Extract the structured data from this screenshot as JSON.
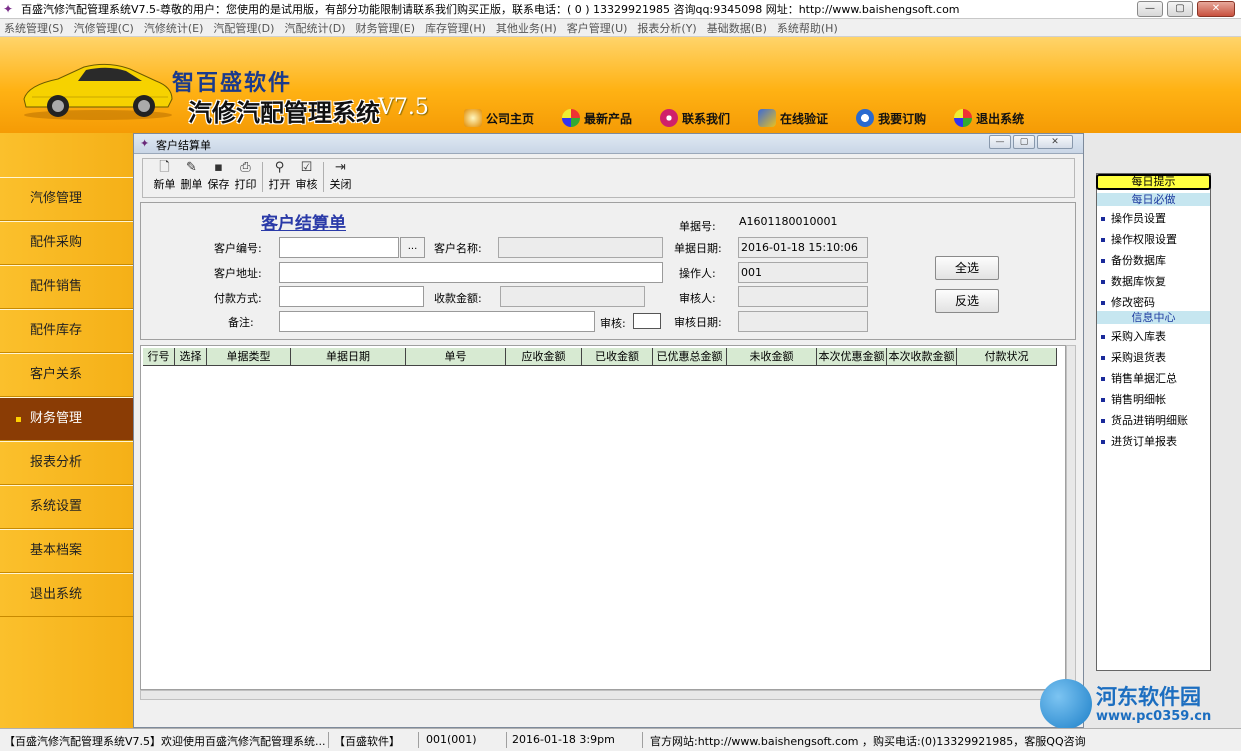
{
  "window": {
    "title": "百盛汽修汽配管理系统V7.5-尊敬的用户：您使用的是试用版，有部分功能限制请联系我们购买正版，联系电话：( 0 ) 13329921985 咨询qq:9345098   网址：http://www.baishengsoft.com"
  },
  "menu": [
    "系统管理(S)",
    "汽修管理(C)",
    "汽修统计(E)",
    "汽配管理(D)",
    "汽配统计(D)",
    "财务管理(E)",
    "库存管理(H)",
    "其他业务(H)",
    "客户管理(U)",
    "报表分析(Y)",
    "基础数据(B)",
    "系统帮助(H)"
  ],
  "banner": {
    "logo_top": "智百盛软件",
    "logo_main": "汽修汽配管理系统",
    "logo_version": "V7.5",
    "nav": [
      "公司主页",
      "最新产品",
      "联系我们",
      "在线验证",
      "我要订购",
      "退出系统"
    ]
  },
  "sidebar": {
    "items": [
      "汽修管理",
      "配件采购",
      "配件销售",
      "配件库存",
      "客户关系",
      "财务管理",
      "报表分析",
      "系统设置",
      "基本档案",
      "退出系统"
    ],
    "active_index": 5
  },
  "child_window": {
    "title": "客户结算单",
    "toolbar": [
      "新单",
      "删单",
      "保存",
      "打印",
      "打开",
      "审核",
      "关闭"
    ],
    "form": {
      "title": "客户结算单",
      "customer_no_label": "客户编号:",
      "customer_no_value": "",
      "customer_no_button": "...",
      "customer_name_label": "客户名称:",
      "customer_name_value": "",
      "customer_address_label": "客户地址:",
      "customer_address_value": "",
      "payment_method_label": "付款方式:",
      "payment_method_value": "",
      "received_amount_label": "收款金额:",
      "received_amount_value": "",
      "remark_label": "备注:",
      "remark_value": "",
      "audit_label": "审核:",
      "doc_no_label": "单据号:",
      "doc_no_value": "A1601180010001",
      "doc_date_label": "单据日期:",
      "doc_date_value": "2016-01-18 15:10:06",
      "operator_label": "操作人:",
      "operator_value": "001",
      "auditor_label": "审核人:",
      "auditor_value": "",
      "audit_date_label": "审核日期:",
      "audit_date_value": "",
      "select_all_button": "全选",
      "invert_button": "反选"
    },
    "table": {
      "columns": [
        "行号",
        "选择",
        "单据类型",
        "单据日期",
        "单号",
        "应收金额",
        "已收金额",
        "已优惠总金额",
        "未收金额",
        "本次优惠金额",
        "本次收款金额",
        "付款状况"
      ],
      "rows": []
    }
  },
  "right_panel": {
    "header": "每日提示",
    "section1": "每日必做",
    "section1_items": [
      "操作员设置",
      "操作权限设置",
      "备份数据库",
      "数据库恢复",
      "修改密码"
    ],
    "section2": "信息中心",
    "section2_items": [
      "采购入库表",
      "采购退货表",
      "销售单据汇总",
      "销售明细帐",
      "货品进销明细账",
      "进货订单报表"
    ]
  },
  "watermark": {
    "name": "河东软件园",
    "url": "www.pc0359.cn"
  },
  "status_bar": {
    "app": "【百盛汽修汽配管理系统V7.5】欢迎使用百盛汽修汽配管理系统...",
    "company": "【百盛软件】",
    "user": "001(001)",
    "datetime": "2016-01-18 3:9pm",
    "info": "官方网站:http://www.baishengsoft.com ，购买电话:(0)13329921985，客服QQ咨询"
  },
  "colors": {
    "banner": "#ffb214",
    "sidebar": "#f7b41f",
    "sidebar_active": "#8a3c05",
    "grid_header": "#d7ead2",
    "form_title": "#2a3aa8"
  }
}
